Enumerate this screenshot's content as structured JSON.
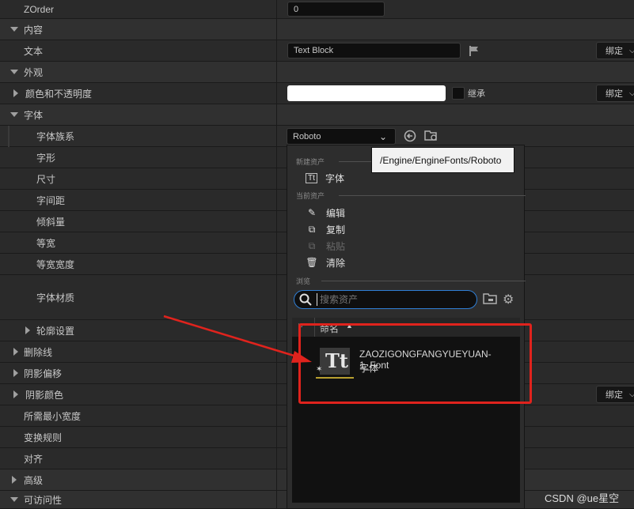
{
  "properties": {
    "zorder": {
      "label": "ZOrder",
      "value": "0"
    },
    "cat_content": "内容",
    "text": {
      "label": "文本",
      "value": "Text Block"
    },
    "cat_appearance": "外观",
    "color_opacity": {
      "label": "颜色和不透明度",
      "inherit_label": "继承"
    },
    "cat_font": "字体",
    "font_family": {
      "label": "字体族系",
      "value": "Roboto"
    },
    "typeface": "字形",
    "size": "尺寸",
    "letter_spacing": "字间距",
    "skew": "倾斜量",
    "monospace": "等宽",
    "monospace_width": "等宽宽度",
    "font_material": "字体材质",
    "outline": "轮廓设置",
    "strikethrough": "删除线",
    "shadow_offset": "阴影偏移",
    "shadow_color": "阴影颜色",
    "min_width": "所需最小宽度",
    "transform_policy": "变换规则",
    "justification": "对齐",
    "cat_advanced": "高级",
    "cat_accessibility": "可访问性",
    "bind_label": "绑定"
  },
  "popup": {
    "section_new": "新建资产",
    "new_font": "字体",
    "section_current": "当前资产",
    "edit": "编辑",
    "copy": "复制",
    "paste": "粘贴",
    "clear": "清除",
    "section_browse": "浏览",
    "search_placeholder": "搜索资产",
    "column_name": "命名",
    "asset": {
      "name": "ZAOZIGONGFANGYUEYUAN-1_Font",
      "type": "字体"
    }
  },
  "tooltip": "/Engine/EngineFonts/Roboto",
  "watermark": "CSDN @ue星空",
  "colors": {
    "annotation": "#e0231d",
    "selection_line": "#b8a030"
  }
}
